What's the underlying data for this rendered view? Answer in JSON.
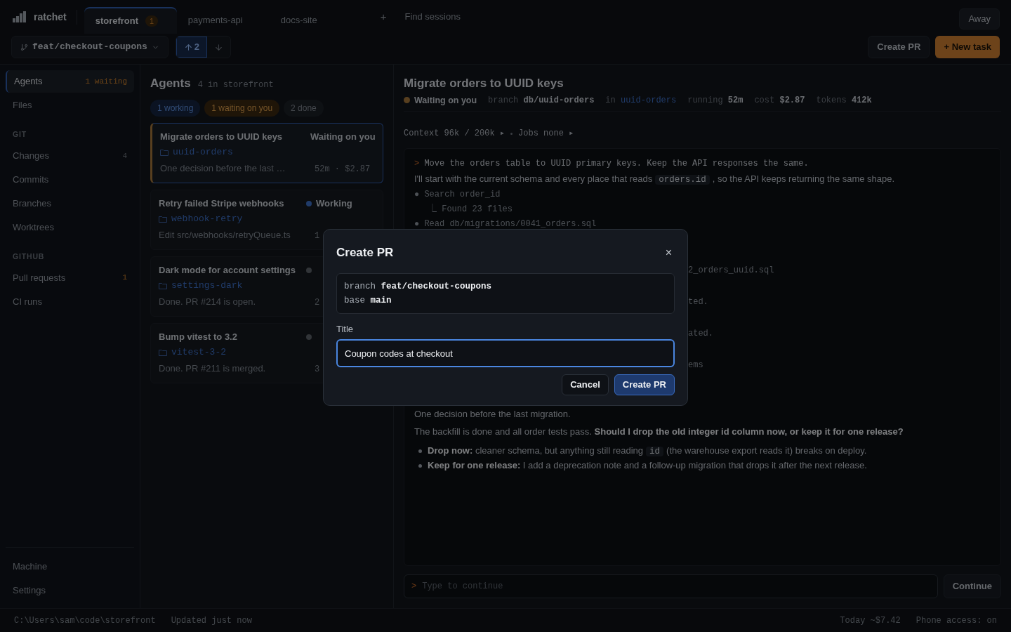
{
  "app": {
    "name": "ratchet"
  },
  "tabs": [
    {
      "label": "storefront",
      "badge": "1",
      "selected": true
    },
    {
      "label": "payments-api",
      "selected": false
    },
    {
      "label": "docs-site",
      "selected": false
    }
  ],
  "new_tab": "+",
  "find_sessions": "Find sessions",
  "away": "Away",
  "branch": {
    "name": "feat/checkout-coupons",
    "ahead": "2",
    "ahead_selected": true
  },
  "actions": [
    {
      "label": "Create PR",
      "kind": "secondary"
    },
    {
      "label": "+ New task",
      "kind": "primary"
    }
  ],
  "sidebar": {
    "items": [
      {
        "kind": "item",
        "label": "Agents",
        "count": "1 waiting",
        "highlight": true,
        "selected": true
      },
      {
        "kind": "item",
        "label": "Files",
        "selected": false
      },
      {
        "kind": "heading",
        "label": "GIT"
      },
      {
        "kind": "item",
        "label": "Changes",
        "count": "4",
        "highlight": false,
        "selected": false
      },
      {
        "kind": "item",
        "label": "Commits",
        "selected": false
      },
      {
        "kind": "item",
        "label": "Branches",
        "selected": false
      },
      {
        "kind": "item",
        "label": "Worktrees",
        "selected": false
      },
      {
        "kind": "heading",
        "label": "GITHUB"
      },
      {
        "kind": "item",
        "label": "Pull requests",
        "count": "1",
        "highlight": true,
        "selected": false
      },
      {
        "kind": "item",
        "label": "CI runs",
        "selected": false
      }
    ],
    "footer": [
      {
        "label": "Machine"
      },
      {
        "label": "Settings"
      }
    ]
  },
  "agents": {
    "title": "Agents",
    "subtitle": "4 in storefront",
    "filters": [
      {
        "label": "1 working",
        "kind": "working"
      },
      {
        "label": "1 waiting on you",
        "kind": "waiting"
      },
      {
        "label": "2 done",
        "kind": "done"
      }
    ],
    "cards": [
      {
        "title": "Migrate orders to UUID keys",
        "status": "Waiting on you",
        "kind": "waiting",
        "worktree": "uuid-orders",
        "desc": "One decision before the last …",
        "meta": "52m · $2.87",
        "selected": true
      },
      {
        "title": "Retry failed Stripe webhooks",
        "status": "Working",
        "kind": "working",
        "worktree": "webhook-retry",
        "desc": "Edit src/webhooks/retryQueue.ts",
        "meta": "1",
        "selected": false
      },
      {
        "title": "Dark mode for account settings",
        "kind": "done",
        "worktree": "settings-dark",
        "desc": "Done. PR #214 is open.",
        "meta": "2",
        "selected": false
      },
      {
        "title": "Bump vitest to 3.2",
        "kind": "done",
        "worktree": "vitest-3-2",
        "desc": "Done. PR #211 is merged.",
        "meta": "3",
        "selected": false
      }
    ]
  },
  "task": {
    "title": "Migrate orders to UUID keys",
    "status": {
      "label": "Waiting on you",
      "kind": "waiting"
    },
    "meta": [
      {
        "key": "branch",
        "value": "db/uuid-orders",
        "kind": "plain"
      },
      {
        "key": "in",
        "value": "uuid-orders",
        "kind": "link"
      },
      {
        "key": "running",
        "value": "52m",
        "kind": "plain"
      },
      {
        "key": "cost",
        "value": "$2.87",
        "kind": "plain"
      },
      {
        "key": "tokens",
        "value": "412k",
        "kind": "plain"
      }
    ],
    "context": "Context 96k / 200k ▸",
    "jobs": "Jobs none ▸",
    "transcript": [
      {
        "kind": "prompt",
        "mark": ">",
        "text": "Move the orders table to UUID primary keys. Keep the API responses the same."
      },
      {
        "kind": "prose",
        "before": "I'll start with the current schema and every place that reads",
        "code": "orders.id",
        "after": ", so the API keeps returning the same shape."
      },
      {
        "kind": "tool",
        "text": "● Search order_id"
      },
      {
        "kind": "result",
        "text": "⎿ Found 23 files"
      },
      {
        "kind": "tool",
        "text": "● Read db/migrations/0041_orders.sql"
      },
      {
        "kind": "fragment",
        "text": "2_orders_uuid.sql"
      },
      {
        "kind": "fragment",
        "text": "ted."
      },
      {
        "kind": "fragment",
        "text": "ated."
      },
      {
        "kind": "fragment",
        "text": "ems"
      },
      {
        "kind": "prose",
        "before": "One decision before the last migration."
      },
      {
        "kind": "prose",
        "before": "The backfill is done and all order tests pass. **Should I drop the old integer id column now, or keep it for one release?**"
      },
      {
        "kind": "bullet",
        "before": "**Drop now:** cleaner schema, but anything still reading",
        "code": "id",
        "after": "(the warehouse export reads it) breaks on deploy."
      },
      {
        "kind": "bullet",
        "before": "**Keep for one release:** I add a deprecation note and a follow-up migration that drops it after the next release."
      }
    ],
    "input": {
      "mark": ">",
      "placeholder": "Type to continue"
    },
    "continue": "Continue"
  },
  "status_bar": {
    "path": "C:\\Users\\sam\\code\\storefront",
    "updated": "Updated just now",
    "today": "Today ~$7.42",
    "phone": "Phone access: on"
  },
  "dialog": {
    "title": "Create PR",
    "close": "×",
    "branch_key": "branch",
    "branch": "feat/checkout-coupons",
    "base_key": "base",
    "base": "main",
    "field_label": "Title",
    "value": "Coupon codes at checkout",
    "cancel": "Cancel",
    "submit": "Create PR"
  }
}
